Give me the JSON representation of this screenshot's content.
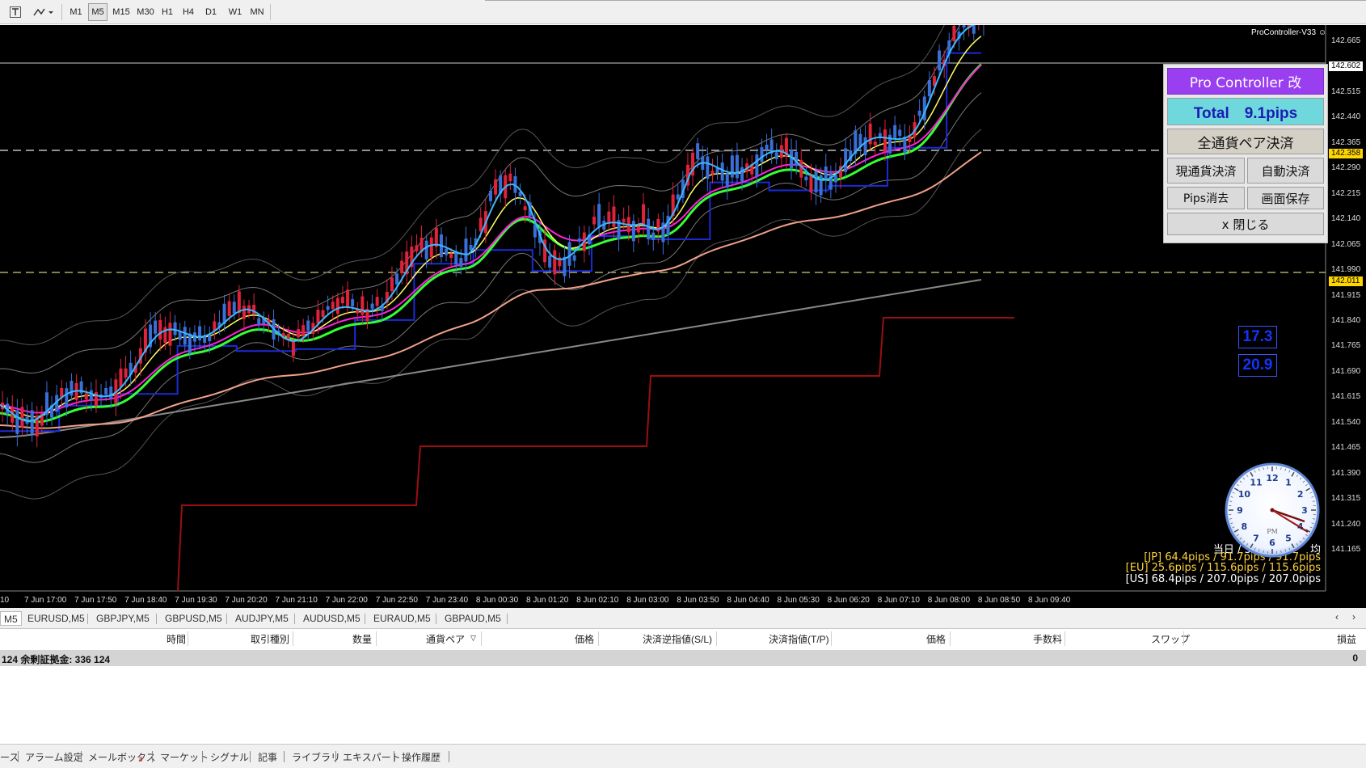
{
  "toolbar": {
    "timeframes": [
      "M1",
      "M5",
      "M15",
      "M30",
      "H1",
      "H4",
      "D1",
      "W1",
      "MN"
    ],
    "active_timeframe": "M5"
  },
  "chart": {
    "indicator_title": "ProController-V33",
    "price_axis": [
      "142.665",
      "142.590",
      "142.515",
      "142.440",
      "142.365",
      "142.290",
      "142.215",
      "142.140",
      "142.065",
      "141.990",
      "141.915",
      "141.840",
      "141.765",
      "141.690",
      "141.615",
      "141.540",
      "141.465",
      "141.390",
      "141.315",
      "141.240",
      "141.165"
    ],
    "current_price_tag": "142.602",
    "yellow_tag_1": "142.358",
    "yellow_tag_2": "142.011",
    "time_axis": [
      "10",
      "7 Jun 17:00",
      "7 Jun 17:50",
      "7 Jun 18:40",
      "7 Jun 19:30",
      "7 Jun 20:20",
      "7 Jun 21:10",
      "7 Jun 22:00",
      "7 Jun 22:50",
      "7 Jun 23:40",
      "8 Jun 00:30",
      "8 Jun 01:20",
      "8 Jun 02:10",
      "8 Jun 03:00",
      "8 Jun 03:50",
      "8 Jun 04:40",
      "8 Jun 05:30",
      "8 Jun 06:20",
      "8 Jun 07:10",
      "8 Jun 08:00",
      "8 Jun 08:50",
      "8 Jun 09:40"
    ],
    "colors": {
      "background": "#000000",
      "bull_candle": "#3a6fd8",
      "bear_candle": "#e0223a",
      "ma_fast": "#39b8ff",
      "ma_yellow": "#ffff66",
      "ma_magenta": "#ff22dd",
      "ichimoku_green": "#33ff33",
      "kijun_blue": "#1a2bd6",
      "ma_salmon": "#f0a088",
      "ma_gray": "#888888",
      "stop_line_red": "#9a0f0f"
    }
  },
  "panel": {
    "title": "Pro Controller 改",
    "total": "Total　9.1pips",
    "close_all_pairs": "全通貨ペア決済",
    "close_current": "現通貨決済",
    "auto_close": "自動決済",
    "pips_clear": "Pips消去",
    "screen_save": "画面保存",
    "close_panel": "x 閉じる"
  },
  "boxes": {
    "value1": "17.3",
    "value2": "20.9"
  },
  "stats": {
    "header": "当日 / 30　　　　　均",
    "jp": "[JP] 64.4pips / 91.7pips / 91.7pips",
    "eu": "[EU] 25.6pips / 115.6pips / 115.6pips",
    "us": "[US] 68.4pips / 207.0pips / 207.0pips"
  },
  "clock": {
    "numbers": [
      "12",
      "1",
      "2",
      "3",
      "4",
      "5",
      "6",
      "7",
      "8",
      "9",
      "10",
      "11"
    ],
    "ampm": "PM"
  },
  "symbol_tabs": [
    "M5",
    "EURUSD,M5",
    "GBPJPY,M5",
    "GBPUSD,M5",
    "AUDJPY,M5",
    "AUDUSD,M5",
    "EURAUD,M5",
    "GBPAUD,M5"
  ],
  "terminal": {
    "columns": [
      "時間",
      "取引種別",
      "数量",
      "通貨ペア",
      "価格",
      "決済逆指値(S/L)",
      "決済指値(T/P)",
      "価格",
      "手数料",
      "スワップ",
      "損益"
    ],
    "balance_text": "124  余剰証拠金: 336 124",
    "balance_profit": "0"
  },
  "bottom_tabs": [
    "ース",
    "アラーム設定",
    "メールボックス",
    "マーケット",
    "シグナル",
    "記事",
    "ライブラリ",
    "エキスパート",
    "操作履歴"
  ],
  "mailbox_badge": "8"
}
